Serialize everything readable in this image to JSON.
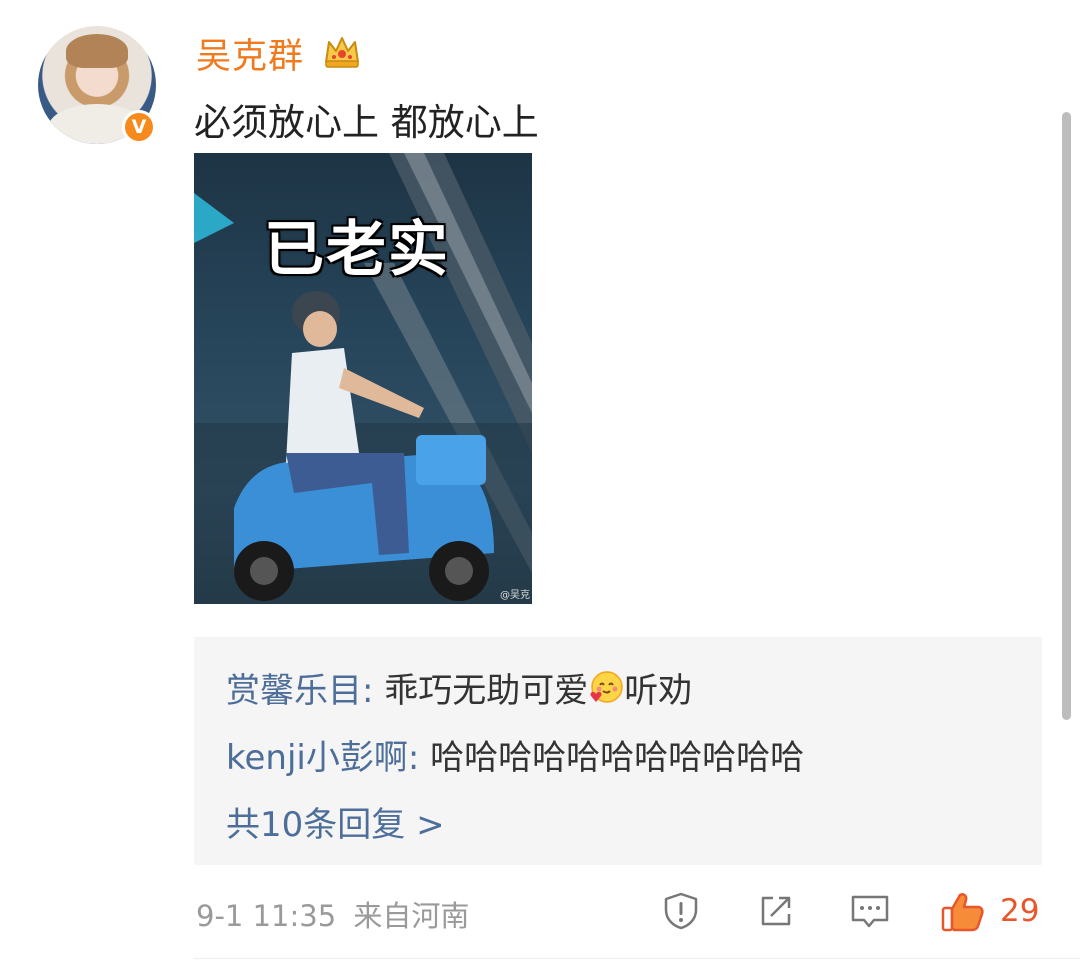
{
  "post": {
    "author": "吴克群",
    "verified_badge": "V",
    "text": "必须放心上 都放心上",
    "image_overlay_text": "已老实",
    "image_watermark": "@吴克",
    "timestamp": "9-1 11:35",
    "source": "来自河南",
    "like_count": "29"
  },
  "replies": [
    {
      "name": "赏馨乐目",
      "separator": ": ",
      "text_before": "乖巧无助可爱",
      "emoji": "smiling-face-with-heart-icon",
      "text_after": "听劝"
    },
    {
      "name": "kenji小彭啊",
      "separator": ": ",
      "text": "哈哈哈哈哈哈哈哈哈哈哈"
    }
  ],
  "more_replies": "共10条回复 >",
  "colors": {
    "username": "#f07a1e",
    "link_blue": "#4e6e9a",
    "like_red": "#e8562c",
    "meta_gray": "#9a9a9a",
    "reply_bg": "#f5f5f5"
  },
  "icons": [
    "crown-icon",
    "report-icon",
    "share-icon",
    "comment-icon",
    "like-icon"
  ]
}
